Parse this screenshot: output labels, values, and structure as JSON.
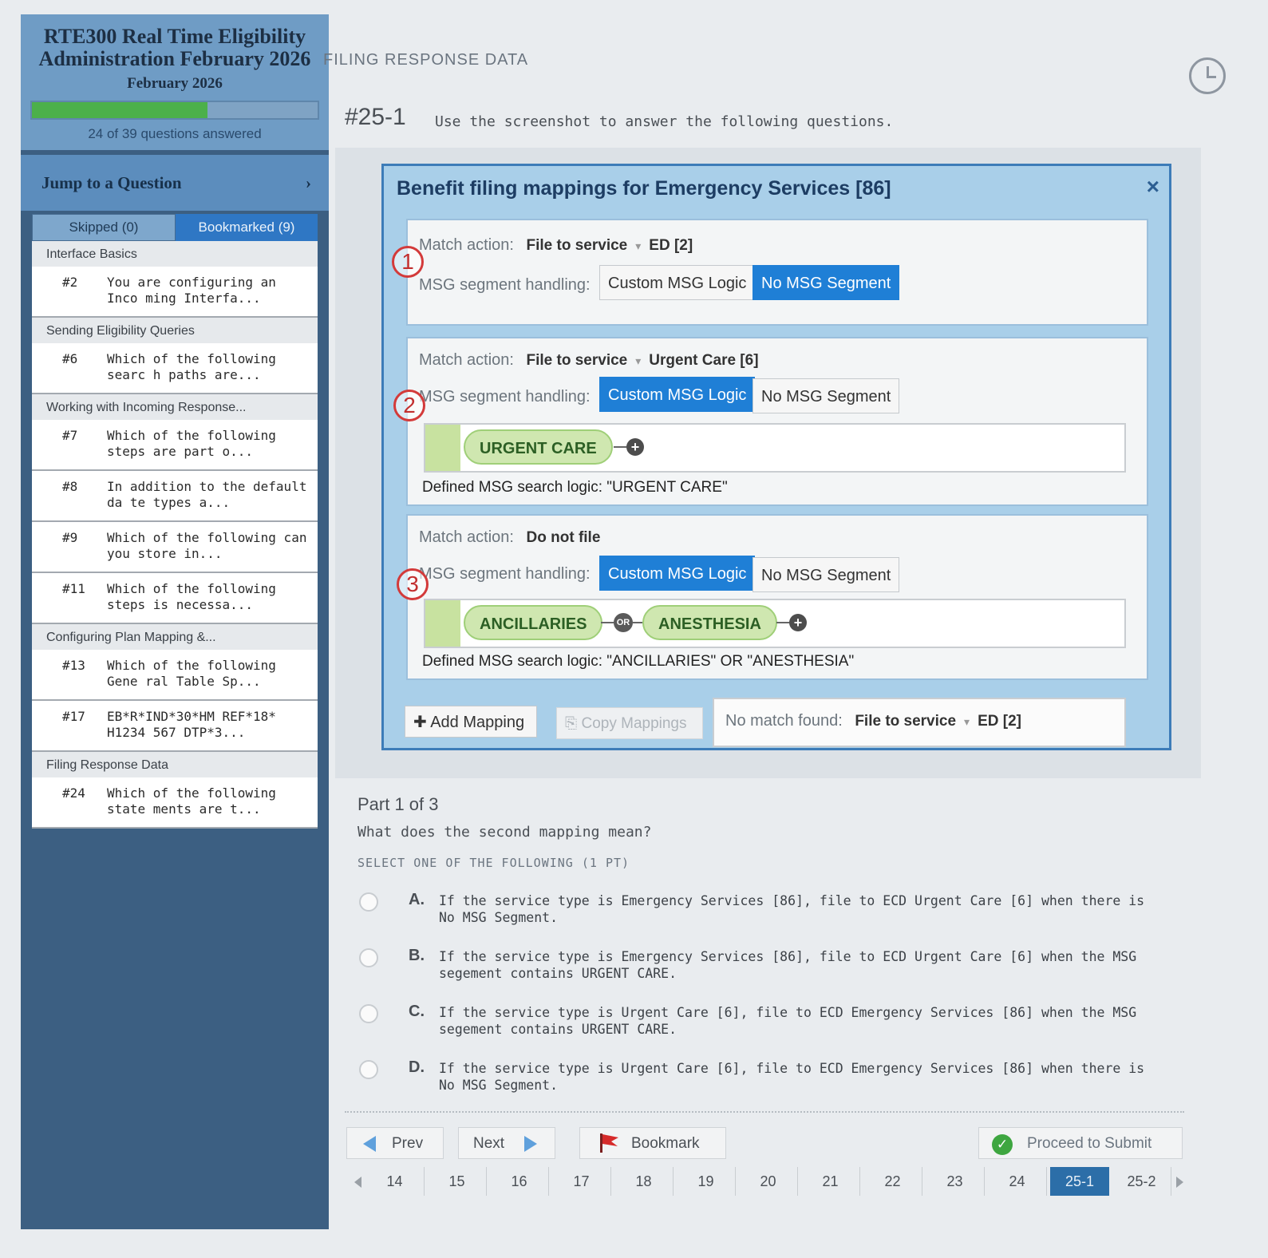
{
  "sidebar": {
    "course_title": "RTE300 Real Time Eligibility Administration February 2026",
    "course_date": "February 2026",
    "progress_fraction": 0.615,
    "progress_text": "24 of 39 questions answered",
    "jump_label": "Jump to a Question",
    "tab_skipped": "Skipped (0)",
    "tab_bookmarked": "Bookmarked (9)",
    "sections": [
      {
        "title": "Interface Basics",
        "items": [
          {
            "num": "#2",
            "text": "You are configuring an Inco ming Interfa..."
          }
        ]
      },
      {
        "title": "Sending Eligibility Queries",
        "items": [
          {
            "num": "#6",
            "text": "Which of the following searc h paths are..."
          }
        ]
      },
      {
        "title": "Working with Incoming Response...",
        "items": [
          {
            "num": "#7",
            "text": "Which of the following steps are part o..."
          },
          {
            "num": "#8",
            "text": "In addition to the default da te types a..."
          },
          {
            "num": "#9",
            "text": "Which of the following can you store in..."
          },
          {
            "num": "#11",
            "text": "Which of the following steps is necessa..."
          }
        ]
      },
      {
        "title": "Configuring Plan Mapping &...",
        "items": [
          {
            "num": "#13",
            "text": "Which of the following Gene ral Table Sp..."
          },
          {
            "num": "#17",
            "text": "EB*R*IND*30*HM REF*18* H1234 567 DTP*3..."
          }
        ]
      },
      {
        "title": "Filing Response Data",
        "items": [
          {
            "num": "#24",
            "text": "Which of the following state ments are t..."
          }
        ]
      }
    ]
  },
  "main": {
    "page_label": "FILING RESPONSE DATA",
    "question_number": "#25-1",
    "instruction": "Use the screenshot to answer the following questions."
  },
  "screenshot": {
    "title": "Benefit filing mappings for Emergency Services [86]",
    "close_glyph": "×",
    "match_action_label": "Match action:",
    "msg_label": "MSG segment handling:",
    "custom_label": "Custom MSG Logic",
    "no_msg_label": "No MSG Segment",
    "mappings": [
      {
        "callout": "1",
        "action": "File to service",
        "service": "ED [2]"
      },
      {
        "callout": "2",
        "action": "File to service",
        "service": "Urgent Care [6]",
        "pill1": "URGENT CARE",
        "defined": "Defined MSG search logic: \"URGENT CARE\""
      },
      {
        "callout": "3",
        "action": "Do not file",
        "pill1": "ANCILLARIES",
        "or_glyph": "OR",
        "pill2": "ANESTHESIA",
        "defined": "Defined MSG search logic: \"ANCILLARIES\" OR \"ANESTHESIA\""
      }
    ],
    "add_mapping": "Add Mapping",
    "copy_mappings": "Copy Mappings",
    "no_match_label": "No match found:",
    "no_match_action": "File to service",
    "no_match_service": "ED [2]"
  },
  "question": {
    "part": "Part 1 of 3",
    "text": "What does the second mapping mean?",
    "hint": "SELECT ONE OF THE FOLLOWING (1 PT)",
    "options": [
      {
        "letter": "A.",
        "text": "If the service type is Emergency Services [86], file to ECD Urgent Care [6] when there is No MSG Segment."
      },
      {
        "letter": "B.",
        "text": "If the service type is Emergency Services [86], file to ECD Urgent Care [6] when the MSG segement contains URGENT CARE."
      },
      {
        "letter": "C.",
        "text": "If the service type is Urgent Care [6], file to ECD Emergency Services [86] when the MSG segement contains URGENT CARE."
      },
      {
        "letter": "D.",
        "text": "If the service type is Urgent Care [6], file to ECD Emergency Services [86] when there is No MSG Segment."
      }
    ]
  },
  "nav": {
    "prev": "Prev",
    "next": "Next",
    "bookmark": "Bookmark",
    "submit": "Proceed to Submit",
    "pages": [
      "14",
      "15",
      "16",
      "17",
      "18",
      "19",
      "20",
      "21",
      "22",
      "23",
      "24",
      "25-1",
      "25-2"
    ],
    "active_page": "25-1"
  },
  "colors": {
    "sidebar_bg": "#3c5f82",
    "accent_blue": "#1f7fd6",
    "progress_green": "#4cb04a",
    "callout_red": "#d33a3a",
    "pill_green": "#cfe7b0"
  }
}
